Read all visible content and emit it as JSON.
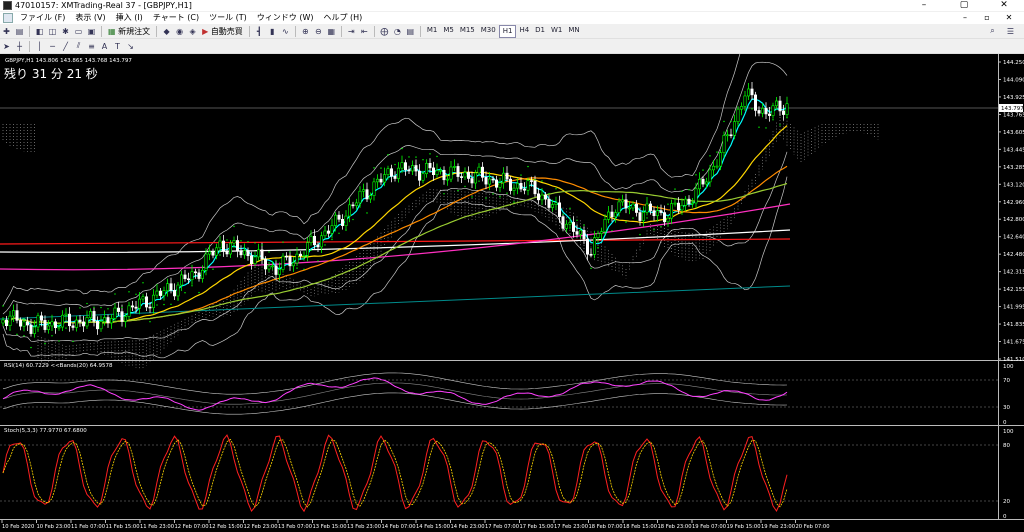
{
  "window": {
    "title": "47010157: XMTrading-Real 37 - [GBPJPY,H1]",
    "controls": [
      "–",
      "▢",
      "✕"
    ]
  },
  "menu": {
    "items": [
      "ファイル (F)",
      "表示 (V)",
      "挿入 (I)",
      "チャート (C)",
      "ツール (T)",
      "ウィンドウ (W)",
      "ヘルプ (H)"
    ],
    "mdi_controls": [
      "–",
      "▫",
      "✕"
    ]
  },
  "toolbar": {
    "new_order_label": "新規注文",
    "auto_trade_label": "自動売買",
    "timeframes": [
      "M1",
      "M5",
      "M15",
      "M30",
      "H1",
      "H4",
      "D1",
      "W1",
      "MN"
    ],
    "active_timeframe": "H1"
  },
  "chart": {
    "symbol_info": "GBPJPY,H1  143.806 143.865 143.768 143.797",
    "countdown": "残り 31 分 21 秒",
    "current_price": "143.797",
    "price_labels": [
      "144.250",
      "144.090",
      "143.925",
      "143.765",
      "143.605",
      "143.445",
      "143.285",
      "143.120",
      "142.960",
      "142.800",
      "142.640",
      "142.480",
      "142.315",
      "142.155",
      "141.995",
      "141.835",
      "141.675",
      "141.510"
    ],
    "rsi_info": "RSI(14) 60.7229   <<Bands(20) 64.9578",
    "rsi_labels": [
      "100",
      "70",
      "30",
      "0"
    ],
    "stoch_info": "Stoch(5,3,3) 77.9770 67.6800",
    "stoch_labels": [
      "100",
      "80",
      "20",
      "0"
    ],
    "time_labels": [
      "10 Feb 2020",
      "10 Feb 23:00",
      "11 Feb 07:00",
      "11 Feb 15:00",
      "11 Feb 23:00",
      "12 Feb 07:00",
      "12 Feb 15:00",
      "12 Feb 23:00",
      "13 Feb 07:00",
      "13 Feb 15:00",
      "13 Feb 23:00",
      "14 Feb 07:00",
      "14 Feb 15:00",
      "14 Feb 23:00",
      "17 Feb 07:00",
      "17 Feb 15:00",
      "17 Feb 23:00",
      "18 Feb 07:00",
      "18 Feb 15:00",
      "18 Feb 23:00",
      "19 Feb 07:00",
      "19 Feb 15:00",
      "19 Feb 23:00",
      "20 Feb 07:00"
    ],
    "colors": {
      "background": "#000000",
      "bull": "#00ff00",
      "bear": "#ffffff",
      "sma_short": "#00ffff",
      "sma_mid": "#ffd700",
      "sma_long": "#ff8c00",
      "ema_200": "#ff2020",
      "bands": "#c8c8c8",
      "ichimoku_cloud": "#ffffff",
      "rsi": "#ff40ff",
      "stoch_main": "#ff2020",
      "stoch_signal": "#ffd700",
      "trend_line": "#008b8b"
    }
  }
}
